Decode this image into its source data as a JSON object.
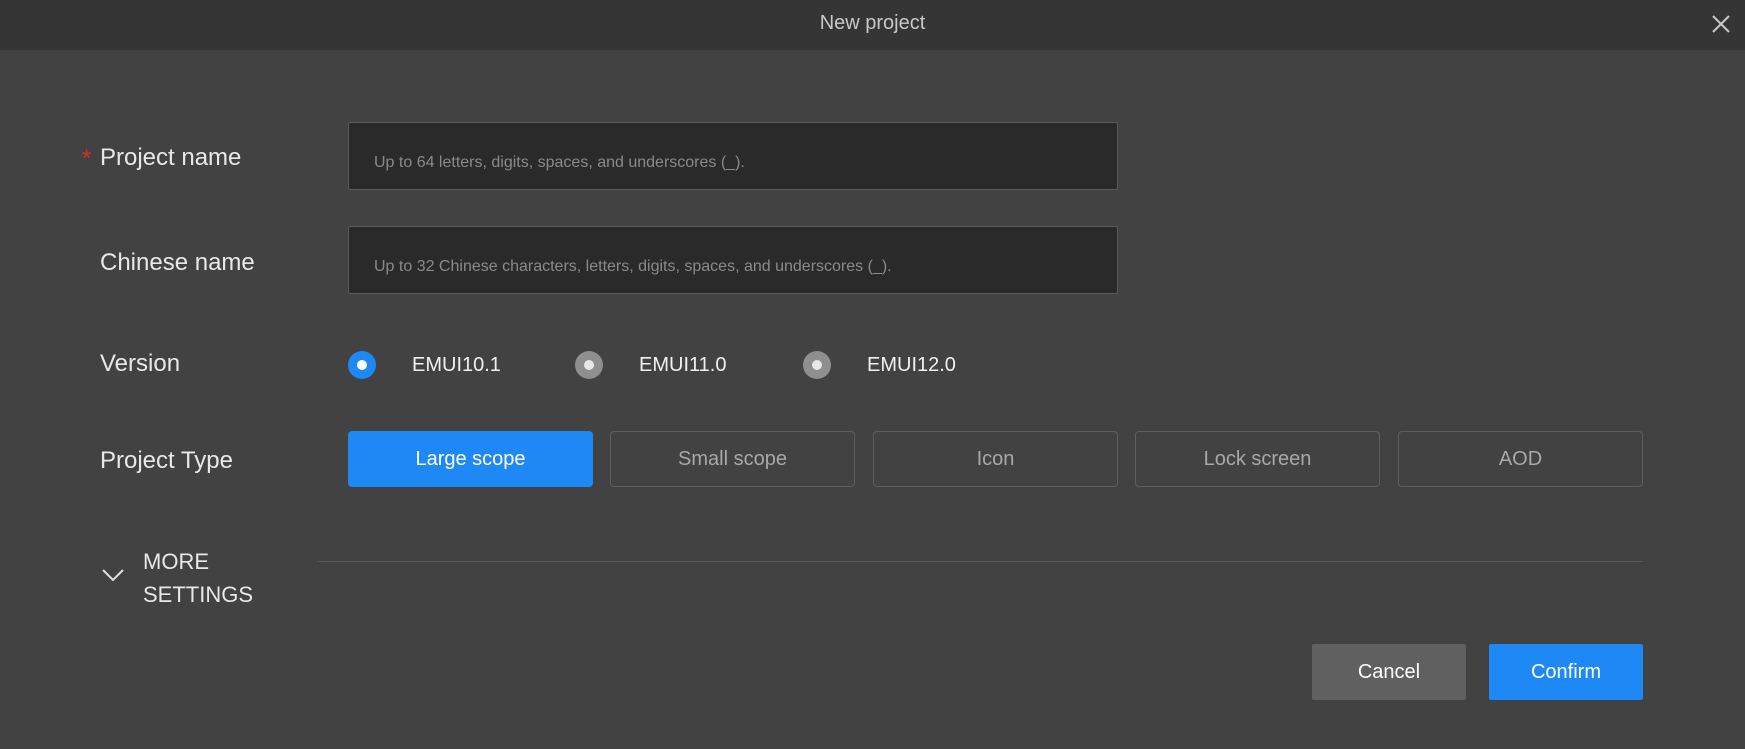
{
  "dialog": {
    "title": "New project"
  },
  "form": {
    "project_name": {
      "label": "Project name",
      "required_mark": "*",
      "value": "",
      "placeholder": "Up to 64 letters, digits, spaces, and underscores (_)."
    },
    "chinese_name": {
      "label": "Chinese name",
      "value": "",
      "placeholder": "Up to 32 Chinese characters, letters, digits, spaces, and underscores (_)."
    },
    "version": {
      "label": "Version",
      "options": [
        {
          "label": "EMUI10.1",
          "selected": true
        },
        {
          "label": "EMUI11.0",
          "selected": false
        },
        {
          "label": "EMUI12.0",
          "selected": false
        }
      ]
    },
    "project_type": {
      "label": "Project Type",
      "options": [
        {
          "label": "Large scope",
          "selected": true
        },
        {
          "label": "Small scope",
          "selected": false
        },
        {
          "label": "Icon",
          "selected": false
        },
        {
          "label": "Lock screen",
          "selected": false
        },
        {
          "label": "AOD",
          "selected": false
        }
      ]
    },
    "more_settings": {
      "line1": "MORE",
      "line2": "SETTINGS",
      "expanded": false
    }
  },
  "footer": {
    "cancel_label": "Cancel",
    "confirm_label": "Confirm"
  },
  "colors": {
    "accent": "#1e88f5",
    "required": "#e02b2b",
    "background": "#424242",
    "titlebar": "#353535"
  },
  "icons": {
    "close": "close-icon",
    "more_toggle": "chevron-down-icon"
  }
}
